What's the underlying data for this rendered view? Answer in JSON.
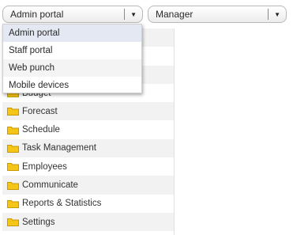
{
  "portal_select": {
    "value": "Admin portal"
  },
  "manager_select": {
    "value": "Manager"
  },
  "dropdown": {
    "options": [
      "Admin portal",
      "Staff portal",
      "Web punch",
      "Mobile devices"
    ],
    "selected": "Admin portal"
  },
  "tree": {
    "items": [
      {
        "label": ""
      },
      {
        "label": ""
      },
      {
        "label": ""
      },
      {
        "label": "Budget"
      },
      {
        "label": "Forecast"
      },
      {
        "label": "Schedule"
      },
      {
        "label": "Task Management"
      },
      {
        "label": "Employees"
      },
      {
        "label": "Communicate"
      },
      {
        "label": "Reports & Statistics"
      },
      {
        "label": "Settings"
      }
    ]
  },
  "colors": {
    "folder": "#f5c518",
    "folder_border": "#c79a00"
  }
}
